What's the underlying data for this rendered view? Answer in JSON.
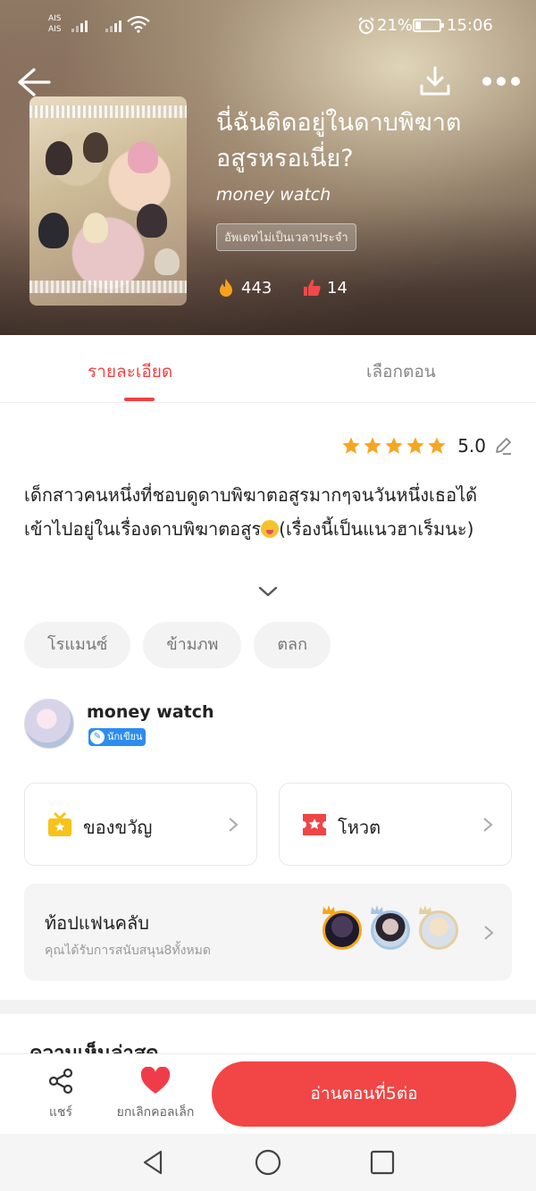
{
  "status_bar": {
    "carrier_1": "AIS",
    "carrier_2": "AIS",
    "battery": "21%",
    "time": "15:06"
  },
  "header": {
    "icons": [
      "back-arrow-icon",
      "download-icon",
      "more-icon"
    ]
  },
  "book": {
    "title": "นี่ฉันติดอยู่ในดาบพิฆาตอสูรหรอเนี่ย?",
    "author": "money watch",
    "update_badge": "อัพเดทไม่เป็นเวลาประจำ",
    "views": "443",
    "likes": "14"
  },
  "tabs": [
    {
      "label": "รายละเอียด",
      "active": true
    },
    {
      "label": "เลือกตอน",
      "active": false
    }
  ],
  "rating": {
    "stars": 5,
    "value": "5.0"
  },
  "synopsis": {
    "part1": "เด็กสาวคนหนึ่งที่ชอบดูดาบพิฆาตอสูรมากๆจนวันหนึ่งเธอได้เข้าไปอยู่ในเรื่องดาบพิฆาตอสูร",
    "part2": "(เรื่องนี้เป็นแนวฮาเร็มนะ)"
  },
  "tags": [
    "โรแมนซ์",
    "ข้ามภพ",
    "ตลก"
  ],
  "author_block": {
    "name": "money watch",
    "badge": "นักเขียน"
  },
  "cards": {
    "gift_label": "ของขวัญ",
    "vote_label": "โหวต"
  },
  "fanclub": {
    "title": "ท้อปแฟนคลับ",
    "subtitle": "คุณได้รับการสนับสนุน8ทั้งหมด"
  },
  "comments": {
    "heading": "ความเห็นล่าสุด"
  },
  "action_bar": {
    "share_label": "แชร์",
    "collect_label": "ยกเลิกคอลเล็ก",
    "read_label": "อ่านตอนที่5ต่อ"
  },
  "colors": {
    "accent": "#ef4242",
    "star": "#f6a623",
    "read_button": "#f24545"
  }
}
